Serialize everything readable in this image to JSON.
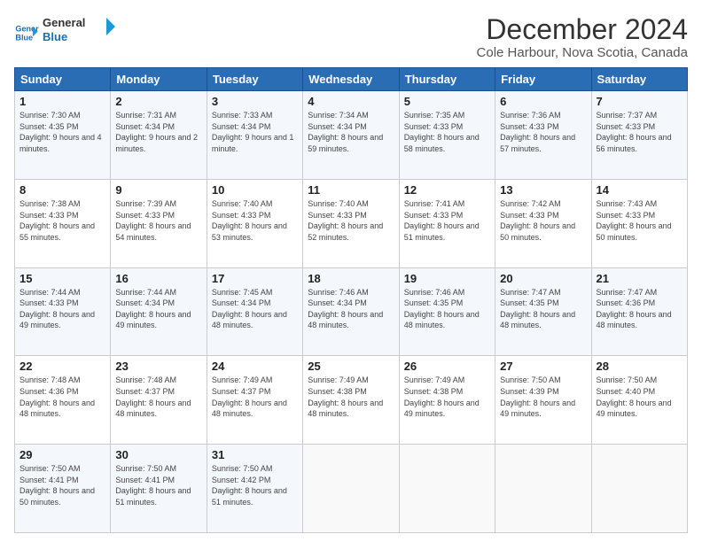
{
  "logo": {
    "line1": "General",
    "line2": "Blue"
  },
  "title": "December 2024",
  "subtitle": "Cole Harbour, Nova Scotia, Canada",
  "days_header": [
    "Sunday",
    "Monday",
    "Tuesday",
    "Wednesday",
    "Thursday",
    "Friday",
    "Saturday"
  ],
  "weeks": [
    [
      {
        "day": "1",
        "sunrise": "Sunrise: 7:30 AM",
        "sunset": "Sunset: 4:35 PM",
        "daylight": "Daylight: 9 hours and 4 minutes."
      },
      {
        "day": "2",
        "sunrise": "Sunrise: 7:31 AM",
        "sunset": "Sunset: 4:34 PM",
        "daylight": "Daylight: 9 hours and 2 minutes."
      },
      {
        "day": "3",
        "sunrise": "Sunrise: 7:33 AM",
        "sunset": "Sunset: 4:34 PM",
        "daylight": "Daylight: 9 hours and 1 minute."
      },
      {
        "day": "4",
        "sunrise": "Sunrise: 7:34 AM",
        "sunset": "Sunset: 4:34 PM",
        "daylight": "Daylight: 8 hours and 59 minutes."
      },
      {
        "day": "5",
        "sunrise": "Sunrise: 7:35 AM",
        "sunset": "Sunset: 4:33 PM",
        "daylight": "Daylight: 8 hours and 58 minutes."
      },
      {
        "day": "6",
        "sunrise": "Sunrise: 7:36 AM",
        "sunset": "Sunset: 4:33 PM",
        "daylight": "Daylight: 8 hours and 57 minutes."
      },
      {
        "day": "7",
        "sunrise": "Sunrise: 7:37 AM",
        "sunset": "Sunset: 4:33 PM",
        "daylight": "Daylight: 8 hours and 56 minutes."
      }
    ],
    [
      {
        "day": "8",
        "sunrise": "Sunrise: 7:38 AM",
        "sunset": "Sunset: 4:33 PM",
        "daylight": "Daylight: 8 hours and 55 minutes."
      },
      {
        "day": "9",
        "sunrise": "Sunrise: 7:39 AM",
        "sunset": "Sunset: 4:33 PM",
        "daylight": "Daylight: 8 hours and 54 minutes."
      },
      {
        "day": "10",
        "sunrise": "Sunrise: 7:40 AM",
        "sunset": "Sunset: 4:33 PM",
        "daylight": "Daylight: 8 hours and 53 minutes."
      },
      {
        "day": "11",
        "sunrise": "Sunrise: 7:40 AM",
        "sunset": "Sunset: 4:33 PM",
        "daylight": "Daylight: 8 hours and 52 minutes."
      },
      {
        "day": "12",
        "sunrise": "Sunrise: 7:41 AM",
        "sunset": "Sunset: 4:33 PM",
        "daylight": "Daylight: 8 hours and 51 minutes."
      },
      {
        "day": "13",
        "sunrise": "Sunrise: 7:42 AM",
        "sunset": "Sunset: 4:33 PM",
        "daylight": "Daylight: 8 hours and 50 minutes."
      },
      {
        "day": "14",
        "sunrise": "Sunrise: 7:43 AM",
        "sunset": "Sunset: 4:33 PM",
        "daylight": "Daylight: 8 hours and 50 minutes."
      }
    ],
    [
      {
        "day": "15",
        "sunrise": "Sunrise: 7:44 AM",
        "sunset": "Sunset: 4:33 PM",
        "daylight": "Daylight: 8 hours and 49 minutes."
      },
      {
        "day": "16",
        "sunrise": "Sunrise: 7:44 AM",
        "sunset": "Sunset: 4:34 PM",
        "daylight": "Daylight: 8 hours and 49 minutes."
      },
      {
        "day": "17",
        "sunrise": "Sunrise: 7:45 AM",
        "sunset": "Sunset: 4:34 PM",
        "daylight": "Daylight: 8 hours and 48 minutes."
      },
      {
        "day": "18",
        "sunrise": "Sunrise: 7:46 AM",
        "sunset": "Sunset: 4:34 PM",
        "daylight": "Daylight: 8 hours and 48 minutes."
      },
      {
        "day": "19",
        "sunrise": "Sunrise: 7:46 AM",
        "sunset": "Sunset: 4:35 PM",
        "daylight": "Daylight: 8 hours and 48 minutes."
      },
      {
        "day": "20",
        "sunrise": "Sunrise: 7:47 AM",
        "sunset": "Sunset: 4:35 PM",
        "daylight": "Daylight: 8 hours and 48 minutes."
      },
      {
        "day": "21",
        "sunrise": "Sunrise: 7:47 AM",
        "sunset": "Sunset: 4:36 PM",
        "daylight": "Daylight: 8 hours and 48 minutes."
      }
    ],
    [
      {
        "day": "22",
        "sunrise": "Sunrise: 7:48 AM",
        "sunset": "Sunset: 4:36 PM",
        "daylight": "Daylight: 8 hours and 48 minutes."
      },
      {
        "day": "23",
        "sunrise": "Sunrise: 7:48 AM",
        "sunset": "Sunset: 4:37 PM",
        "daylight": "Daylight: 8 hours and 48 minutes."
      },
      {
        "day": "24",
        "sunrise": "Sunrise: 7:49 AM",
        "sunset": "Sunset: 4:37 PM",
        "daylight": "Daylight: 8 hours and 48 minutes."
      },
      {
        "day": "25",
        "sunrise": "Sunrise: 7:49 AM",
        "sunset": "Sunset: 4:38 PM",
        "daylight": "Daylight: 8 hours and 48 minutes."
      },
      {
        "day": "26",
        "sunrise": "Sunrise: 7:49 AM",
        "sunset": "Sunset: 4:38 PM",
        "daylight": "Daylight: 8 hours and 49 minutes."
      },
      {
        "day": "27",
        "sunrise": "Sunrise: 7:50 AM",
        "sunset": "Sunset: 4:39 PM",
        "daylight": "Daylight: 8 hours and 49 minutes."
      },
      {
        "day": "28",
        "sunrise": "Sunrise: 7:50 AM",
        "sunset": "Sunset: 4:40 PM",
        "daylight": "Daylight: 8 hours and 49 minutes."
      }
    ],
    [
      {
        "day": "29",
        "sunrise": "Sunrise: 7:50 AM",
        "sunset": "Sunset: 4:41 PM",
        "daylight": "Daylight: 8 hours and 50 minutes."
      },
      {
        "day": "30",
        "sunrise": "Sunrise: 7:50 AM",
        "sunset": "Sunset: 4:41 PM",
        "daylight": "Daylight: 8 hours and 51 minutes."
      },
      {
        "day": "31",
        "sunrise": "Sunrise: 7:50 AM",
        "sunset": "Sunset: 4:42 PM",
        "daylight": "Daylight: 8 hours and 51 minutes."
      },
      null,
      null,
      null,
      null
    ]
  ]
}
